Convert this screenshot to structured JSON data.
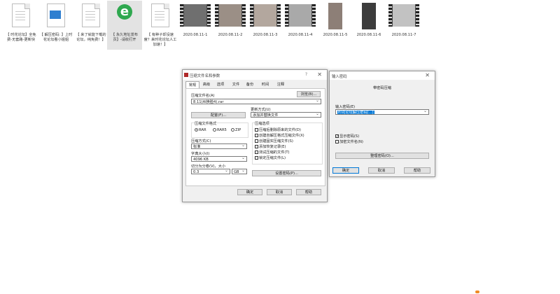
{
  "files": [
    {
      "caption": "【 时花论坛】全免费-无套路-更新快",
      "icon": "document-icon"
    },
    {
      "caption": "【 解压密码: 】上时花论坛看小姐姐",
      "icon": "image-file-icon"
    },
    {
      "caption": "【 来了就能下载的论坛，纯免费！】",
      "icon": "document-icon"
    },
    {
      "caption": "【 永久地址发布页】-请收打开",
      "icon": "internet-explorer-icon"
    },
    {
      "caption": "【 有种子却没速度？来时花论坛人工加速！】",
      "icon": "document-icon"
    },
    {
      "caption": "2020.08.11-1",
      "icon": "video-file-icon"
    },
    {
      "caption": "2020.08.11-2",
      "icon": "video-file-icon"
    },
    {
      "caption": "2020.08.11-3",
      "icon": "video-file-icon"
    },
    {
      "caption": "2020.08.11-4",
      "icon": "video-file-icon"
    },
    {
      "caption": "2020.08.11-5",
      "icon": "video-file-icon"
    },
    {
      "caption": "2020.08.11-6",
      "icon": "video-file-icon"
    },
    {
      "caption": "2020.08.11-7",
      "icon": "video-file-icon"
    }
  ],
  "archive_dialog": {
    "title": "压缩文件名和参数",
    "help_glyph": "?",
    "close_glyph": "✕",
    "tabs": [
      "常规",
      "高级",
      "选项",
      "文件",
      "备份",
      "时间",
      "注释"
    ],
    "archive_name_label": "压缩文件名(A)",
    "browse_button": "浏览(B)...",
    "archive_name_value": "8.11(AI换脸4).rar",
    "profile_button": "配置(F)...",
    "update_mode_label": "更新方式(U)",
    "update_mode_value": "添加并替换文件",
    "format_label": "压缩文件格式",
    "formats": [
      "RAR",
      "RAR5",
      "ZIP"
    ],
    "selected_format": "RAR",
    "method_label": "压缩方式(C)",
    "method_value": "标准",
    "dict_label": "字典大小(I)",
    "dict_value": "4096 KB",
    "split_label": "切分为分卷(V)，大小",
    "split_value": "0.3",
    "split_unit": "GB",
    "options_label": "压缩选项",
    "options": [
      "压缩后删除原来的文件(D)",
      "创建自解压格式压缩文件(X)",
      "创建固实压缩文件(S)",
      "添加恢复记录(E)",
      "测试压缩的文件(T)",
      "锁定压缩文件(L)"
    ],
    "set_password_button": "设置密码(P)...",
    "ok_button": "确定",
    "cancel_button": "取消",
    "help_button": "帮助"
  },
  "password_dialog": {
    "title": "输入密码",
    "close_glyph": "✕",
    "heading": "带密码压缩",
    "enter_label": "输入密码(E)",
    "password_value": "时花论坛解压密码[...]",
    "show_password_label": "显示密码(S)",
    "show_password_checked": true,
    "encrypt_names_label": "加密文件名(N)",
    "encrypt_names_checked": false,
    "organize_button": "整理密码(O)...",
    "ok_button": "确定",
    "cancel_button": "取消",
    "help_button": "帮助"
  },
  "colors": {
    "accent": "#0078d7",
    "dialog_bg": "#f0f0f0"
  }
}
